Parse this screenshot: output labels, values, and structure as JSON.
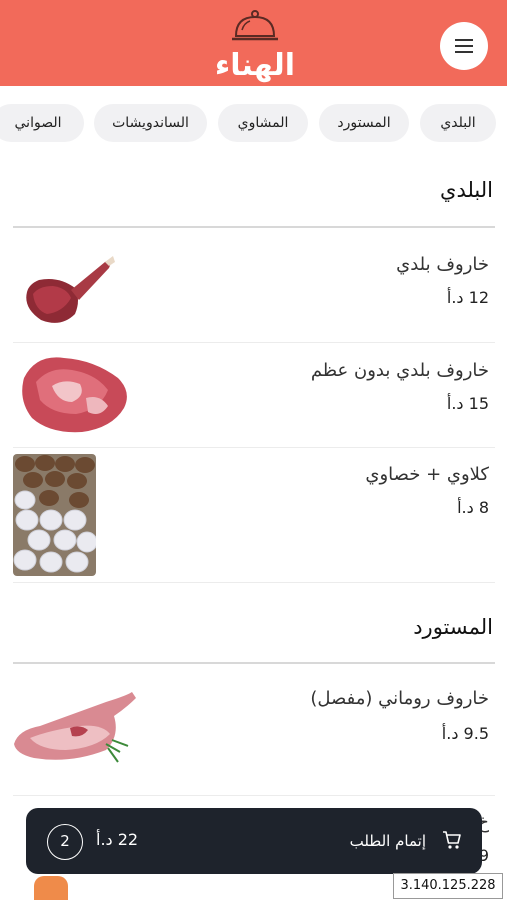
{
  "header": {
    "logo_text": "الهناء",
    "bg_color": "#f26a5a"
  },
  "categories": [
    "البلدي",
    "المستورد",
    "المشاوي",
    "الساندويشات",
    "الصواني"
  ],
  "sections": [
    {
      "title": "البلدي",
      "products": [
        {
          "name": "خاروف بلدي",
          "price": "12 د.أ"
        },
        {
          "name": "خاروف بلدي بدون عظم",
          "price": "15 د.أ"
        },
        {
          "name": "كلاوي + خصاوي",
          "price": "8 د.أ"
        }
      ]
    },
    {
      "title": "المستورد",
      "products": [
        {
          "name": "خاروف روماني (مفصل)",
          "price": "9.5 د.أ"
        }
      ]
    }
  ],
  "partial_product": {
    "name_peek": "خ",
    "price_peek": "9"
  },
  "cart": {
    "count": "2",
    "total": "22 د.أ",
    "checkout_label": "إتمام الطلب"
  },
  "overlay_ip": "3.140.125.228"
}
